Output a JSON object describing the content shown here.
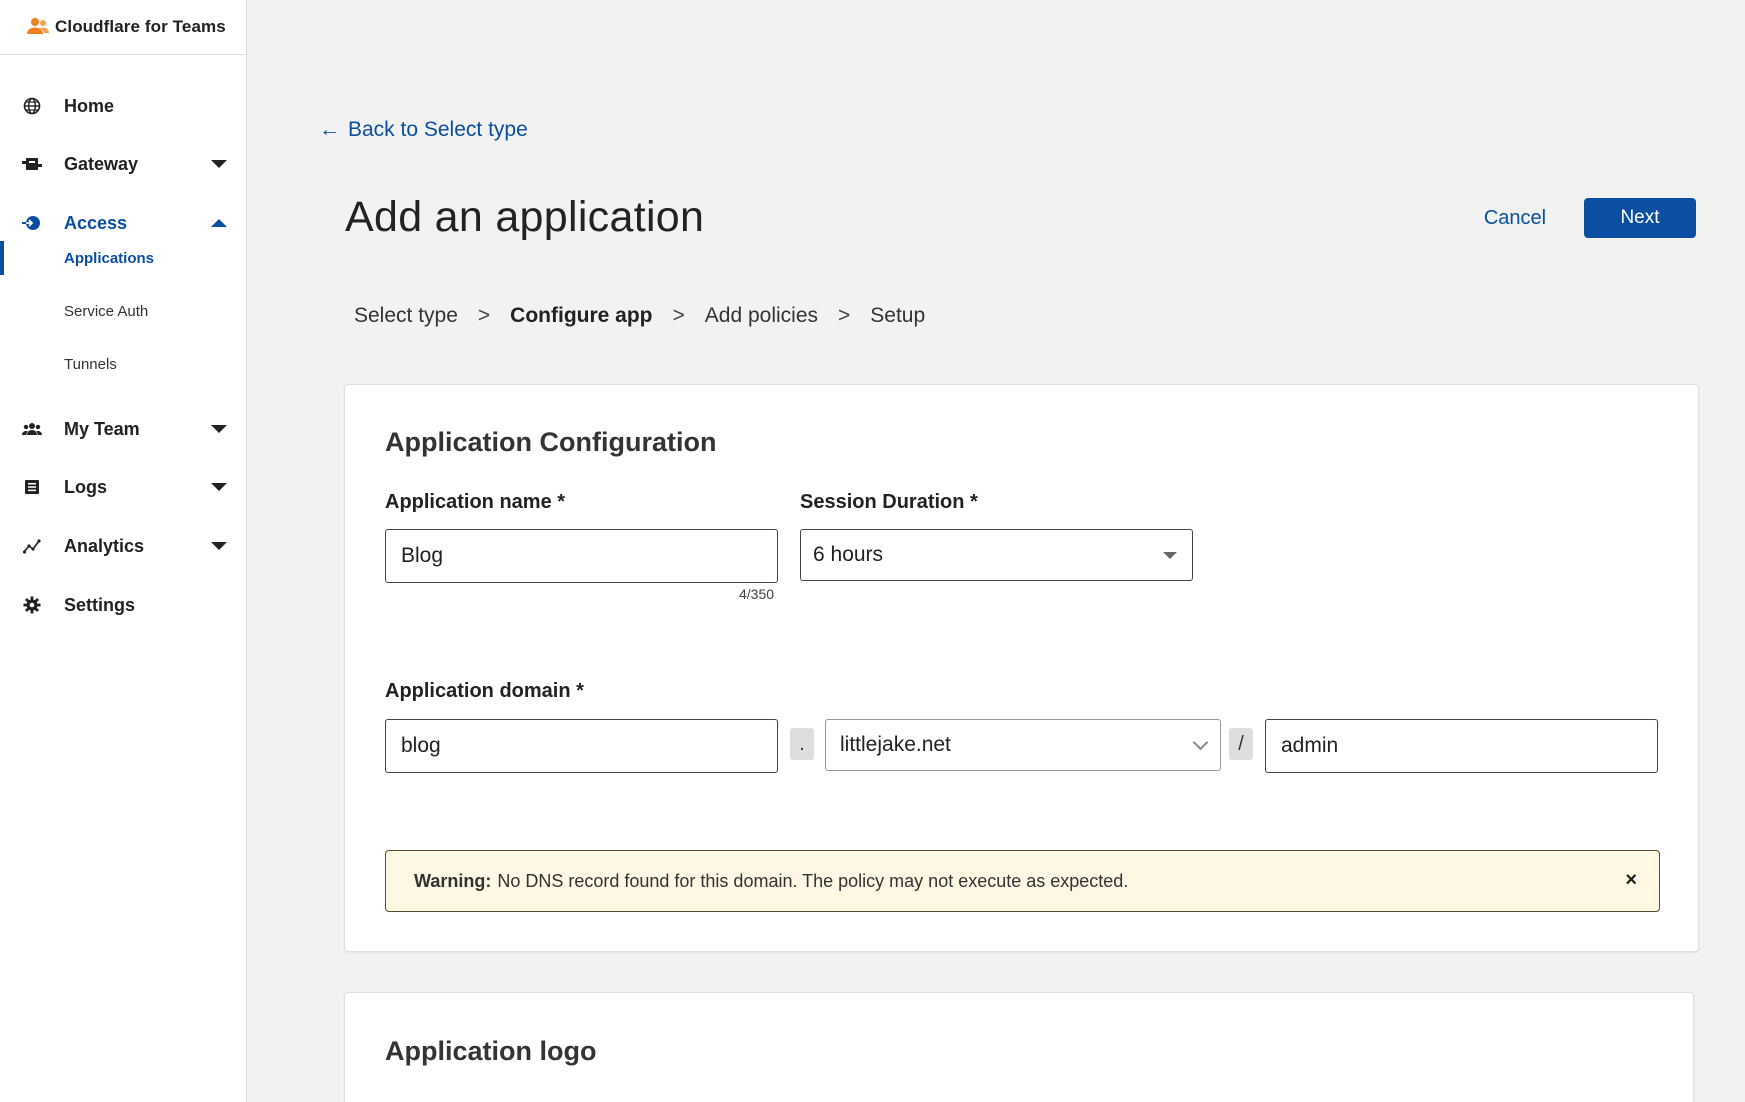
{
  "app": {
    "brand": "Cloudflare for Teams",
    "brand_color": "#f38020",
    "accent": "#0b4ea2"
  },
  "sidebar": {
    "items": [
      {
        "label": "Home",
        "icon": "globe-icon"
      },
      {
        "label": "Gateway",
        "icon": "gateway-icon",
        "expanded": false
      },
      {
        "label": "Access",
        "icon": "access-icon",
        "expanded": true,
        "active": true
      },
      {
        "label": "My Team",
        "icon": "team-icon",
        "expanded": false
      },
      {
        "label": "Logs",
        "icon": "logs-icon",
        "expanded": false
      },
      {
        "label": "Analytics",
        "icon": "analytics-icon",
        "expanded": false
      },
      {
        "label": "Settings",
        "icon": "gear-icon"
      }
    ],
    "access_sub": [
      {
        "label": "Applications",
        "active": true
      },
      {
        "label": "Service Auth"
      },
      {
        "label": "Tunnels"
      }
    ]
  },
  "main": {
    "back_link": "Back to Select type",
    "title": "Add an application",
    "cancel_label": "Cancel",
    "next_label": "Next",
    "steps": [
      {
        "label": "Select type"
      },
      {
        "label": "Configure app",
        "current": true
      },
      {
        "label": "Add policies"
      },
      {
        "label": "Setup"
      }
    ],
    "step_separator": ">"
  },
  "config_card": {
    "title": "Application Configuration",
    "app_name": {
      "label": "Application name *",
      "value": "Blog",
      "counter": "4/350"
    },
    "session": {
      "label": "Session Duration *",
      "value": "6 hours"
    },
    "domain": {
      "label": "Application domain *",
      "subdomain": "blog",
      "dot": ".",
      "domain": "littlejake.net",
      "slash": "/",
      "path": "admin"
    },
    "warning": {
      "prefix": "Warning:",
      "text": "No DNS record found for this domain. The policy may not execute as expected.",
      "close": "×"
    }
  },
  "logo_card": {
    "title": "Application logo"
  }
}
